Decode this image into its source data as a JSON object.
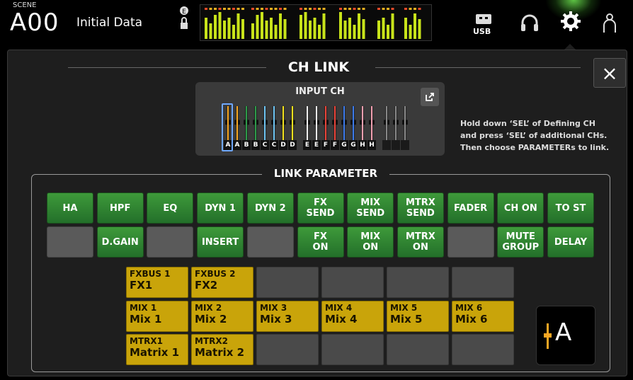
{
  "topbar": {
    "scene_label": "SCENE",
    "scene_number": "A00",
    "scene_name": "Initial Data",
    "icons": [
      "e-lock-icon",
      "lock-icon",
      "usb-icon",
      "headphone-icon",
      "gear-icon",
      "user-icon"
    ],
    "usb_label": "USB",
    "accent_color": "#6ee650"
  },
  "panel": {
    "title": "CH LINK",
    "close_label": "×",
    "input_ch": {
      "title": "INPUT CH",
      "channels": [
        {
          "label": "A",
          "color": "#f5a623"
        },
        {
          "label": "A",
          "color": "#f5a623"
        },
        {
          "label": "B",
          "color": "#2e9b4a"
        },
        {
          "label": "B",
          "color": "#2e9b4a"
        },
        {
          "label": "C",
          "color": "#6fc3f0"
        },
        {
          "label": "C",
          "color": "#6fc3f0"
        },
        {
          "label": "D",
          "color": "#f0e020"
        },
        {
          "label": "D",
          "color": "#f0e020"
        },
        {
          "label": "E",
          "color": "#f0f0f0"
        },
        {
          "label": "E",
          "color": "#f0f0f0"
        },
        {
          "label": "F",
          "color": "#e8443a"
        },
        {
          "label": "F",
          "color": "#e8443a"
        },
        {
          "label": "G",
          "color": "#3d7ae8"
        },
        {
          "label": "G",
          "color": "#3d7ae8"
        },
        {
          "label": "H",
          "color": "#f0a0b0"
        },
        {
          "label": "H",
          "color": "#f0a0b0"
        },
        {
          "label": "",
          "color": "#888888"
        },
        {
          "label": "",
          "color": "#888888"
        },
        {
          "label": "",
          "color": "#888888"
        }
      ]
    },
    "help_text_1": "Hold down ‘SEL’ of Defining CH",
    "help_text_2": "and press ‘SEL’ of additional CHs.",
    "help_text_3": "Then choose PARAMETERs to link.",
    "link_parameter": {
      "title": "LINK PARAMETER",
      "row1": [
        {
          "label": "HA",
          "state": "on"
        },
        {
          "label": "HPF",
          "state": "on"
        },
        {
          "label": "EQ",
          "state": "on"
        },
        {
          "label": "DYN 1",
          "state": "on"
        },
        {
          "label": "DYN 2",
          "state": "on"
        },
        {
          "label": "FX SEND",
          "state": "on"
        },
        {
          "label": "MIX SEND",
          "state": "on"
        },
        {
          "label": "MTRX SEND",
          "state": "on"
        },
        {
          "label": "FADER",
          "state": "on"
        },
        {
          "label": "CH ON",
          "state": "on"
        },
        {
          "label": "TO ST",
          "state": "on"
        }
      ],
      "row2": [
        {
          "label": "",
          "state": "off"
        },
        {
          "label": "D.GAIN",
          "state": "on"
        },
        {
          "label": "",
          "state": "off"
        },
        {
          "label": "INSERT",
          "state": "on"
        },
        {
          "label": "",
          "state": "off"
        },
        {
          "label": "FX ON",
          "state": "on"
        },
        {
          "label": "MIX ON",
          "state": "on"
        },
        {
          "label": "MTRX ON",
          "state": "on"
        },
        {
          "label": "",
          "state": "off"
        },
        {
          "label": "MUTE GROUP",
          "state": "on"
        },
        {
          "label": "DELAY",
          "state": "on"
        }
      ]
    },
    "buses": {
      "row1": [
        {
          "small": "FXBUS 1",
          "big": "FX1",
          "state": "on"
        },
        {
          "small": "FXBUS 2",
          "big": "FX2",
          "state": "on"
        },
        {
          "small": "",
          "big": "",
          "state": "off"
        },
        {
          "small": "",
          "big": "",
          "state": "off"
        },
        {
          "small": "",
          "big": "",
          "state": "off"
        },
        {
          "small": "",
          "big": "",
          "state": "off"
        }
      ],
      "row2": [
        {
          "small": "MIX 1",
          "big": "Mix 1",
          "state": "on"
        },
        {
          "small": "MIX 2",
          "big": "Mix 2",
          "state": "on"
        },
        {
          "small": "MIX 3",
          "big": "Mix 3",
          "state": "on"
        },
        {
          "small": "MIX 4",
          "big": "Mix 4",
          "state": "on"
        },
        {
          "small": "MIX 5",
          "big": "Mix 5",
          "state": "on"
        },
        {
          "small": "MIX 6",
          "big": "Mix 6",
          "state": "on"
        }
      ],
      "row3": [
        {
          "small": "MTRX1",
          "big": "Matrix 1",
          "state": "on"
        },
        {
          "small": "MTRX2",
          "big": "Matrix 2",
          "state": "on"
        },
        {
          "small": "",
          "big": "",
          "state": "off"
        },
        {
          "small": "",
          "big": "",
          "state": "off"
        },
        {
          "small": "",
          "big": "",
          "state": "off"
        },
        {
          "small": "",
          "big": "",
          "state": "off"
        }
      ]
    },
    "selected_link": {
      "letter": "A",
      "color": "#f5a623"
    }
  }
}
